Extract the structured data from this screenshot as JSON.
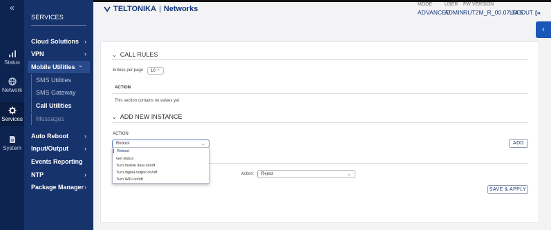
{
  "rail": {
    "collapse_icon": "double-chevron-left-icon",
    "items": [
      {
        "label": "Status",
        "icon": "bar-chart-icon"
      },
      {
        "label": "Network",
        "icon": "globe-icon"
      },
      {
        "label": "Services",
        "icon": "gear-icon"
      },
      {
        "label": "System",
        "icon": "document-icon"
      }
    ]
  },
  "sidebar": {
    "title": "SERVICES",
    "items": [
      {
        "label": "Cloud Solutions",
        "chevron": "›"
      },
      {
        "label": "VPN",
        "chevron": "›"
      },
      {
        "label": "Mobile Utilities",
        "chevron": "⌄"
      },
      {
        "label": "Auto Reboot",
        "chevron": "›"
      },
      {
        "label": "Input/Output",
        "chevron": "›"
      },
      {
        "label": "Events Reporting",
        "chevron": ""
      },
      {
        "label": "NTP",
        "chevron": "›"
      },
      {
        "label": "Package Manager",
        "chevron": "›"
      }
    ],
    "subitems": [
      "SMS Utilities",
      "SMS Gateway",
      "Call Utilities",
      "Messages"
    ]
  },
  "header": {
    "brand": "TELTONIKA",
    "brand_suffix": "Networks",
    "mode_label": "MODE",
    "mode_value": "ADVANCED",
    "user_label": "USER",
    "user_value": "ADMIN",
    "fw_label": "FW VERSION",
    "fw_value": "RUT2M_R_00.07.04.5",
    "logout": "LOGOUT"
  },
  "call_rules": {
    "title": "CALL RULES",
    "entries_label": "Entries per page",
    "entries_value": "10",
    "column_action": "ACTION",
    "empty_text": "This section contains no values yet"
  },
  "new_instance": {
    "title": "ADD NEW INSTANCE",
    "action_label": "ACTION",
    "selected": "Reboot",
    "options": [
      "Reboot",
      "Get status",
      "Turn mobile data on/off",
      "Turn digital output on/off",
      "Turn WiFi on/off"
    ],
    "add_button": "ADD",
    "action2_label": "Action:",
    "action2_value": "Reject",
    "save_button": "SAVE & APPLY"
  },
  "colors": {
    "rail_bg": "#0d2350",
    "sidebar_bg": "#17336b",
    "brand": "#13377a",
    "accent": "#1a57b8"
  }
}
